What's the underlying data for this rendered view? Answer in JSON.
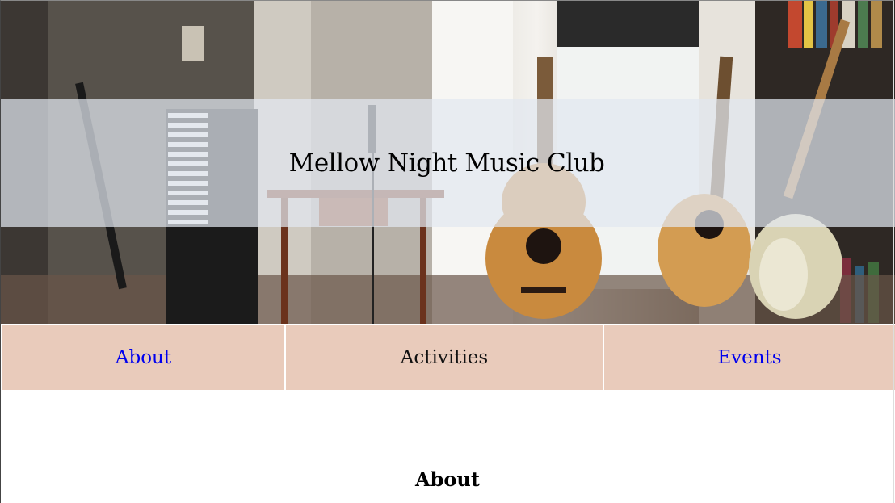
{
  "hero": {
    "title": "Mellow Night Music Club",
    "image_alt": "Music room with guitars, keyboard and microphone"
  },
  "nav": {
    "items": [
      {
        "label": "About",
        "type": "link"
      },
      {
        "label": "Activities",
        "type": "text"
      },
      {
        "label": "Events",
        "type": "link"
      }
    ]
  },
  "main": {
    "section_heading": "About"
  },
  "colors": {
    "nav_background": "#e9cbbb",
    "link": "#0000ee",
    "title_band": "#e2e8f0"
  }
}
